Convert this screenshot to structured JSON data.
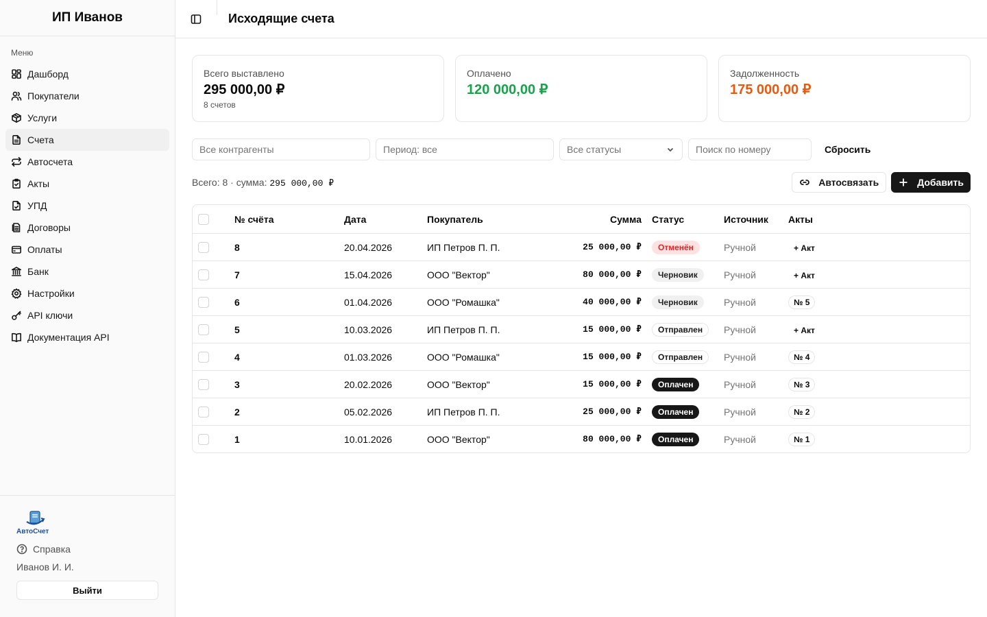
{
  "sidebar": {
    "brand": "ИП Иванов",
    "menu_title": "Меню",
    "items": [
      {
        "label": "Дашборд",
        "icon": "dashboard-icon"
      },
      {
        "label": "Покупатели",
        "icon": "users-icon"
      },
      {
        "label": "Услуги",
        "icon": "package-icon"
      },
      {
        "label": "Счета",
        "icon": "file-text-icon",
        "active": true
      },
      {
        "label": "Автосчета",
        "icon": "repeat-icon"
      },
      {
        "label": "Акты",
        "icon": "clipboard-check-icon"
      },
      {
        "label": "УПД",
        "icon": "file-check-icon"
      },
      {
        "label": "Договоры",
        "icon": "contract-icon"
      },
      {
        "label": "Оплаты",
        "icon": "wallet-icon"
      },
      {
        "label": "Банк",
        "icon": "bank-icon"
      },
      {
        "label": "Настройки",
        "icon": "gear-icon"
      },
      {
        "label": "API ключи",
        "icon": "key-icon"
      },
      {
        "label": "Документация API",
        "icon": "book-icon"
      }
    ],
    "footer": {
      "logo_text": "АвтоСчет",
      "help": "Справка",
      "user": "Иванов И. И.",
      "logout": "Выйти"
    }
  },
  "header": {
    "title": "Исходящие счета"
  },
  "cards": [
    {
      "label": "Всего выставлено",
      "value": "295 000,00 ₽",
      "sub": "8 счетов",
      "color": "#0a0a0a"
    },
    {
      "label": "Оплачено",
      "value": "120 000,00 ₽",
      "sub": "",
      "color": "#16a34a"
    },
    {
      "label": "Задолженность",
      "value": "175 000,00 ₽",
      "sub": "",
      "color": "#ea580c"
    }
  ],
  "filters": {
    "counterparty_placeholder": "Все контрагенты",
    "period_placeholder": "Период: все",
    "status_value": "Все статусы",
    "search_placeholder": "Поиск по номеру",
    "reset": "Сбросить"
  },
  "toolbar": {
    "totals_prefix": "Всего: 8 · сумма:",
    "totals_sum": "295 000,00 ₽",
    "autolink": "Автосвязать",
    "add": "Добавить"
  },
  "table": {
    "columns": [
      "№ счёта",
      "Дата",
      "Покупатель",
      "Сумма",
      "Статус",
      "Источник",
      "Акты"
    ],
    "rows": [
      {
        "num": "8",
        "date": "20.04.2026",
        "buyer": "ИП Петров П. П.",
        "sum": "25 000,00 ₽",
        "status": "Отменён",
        "status_kind": "cancel",
        "source": "Ручной",
        "act": "+ Акт",
        "act_kind": "add"
      },
      {
        "num": "7",
        "date": "15.04.2026",
        "buyer": "ООО \"Вектор\"",
        "sum": "80 000,00 ₽",
        "status": "Черновик",
        "status_kind": "draft",
        "source": "Ручной",
        "act": "+ Акт",
        "act_kind": "add"
      },
      {
        "num": "6",
        "date": "01.04.2026",
        "buyer": "ООО \"Ромашка\"",
        "sum": "40 000,00 ₽",
        "status": "Черновик",
        "status_kind": "draft",
        "source": "Ручной",
        "act": "№ 5",
        "act_kind": "chip"
      },
      {
        "num": "5",
        "date": "10.03.2026",
        "buyer": "ИП Петров П. П.",
        "sum": "15 000,00 ₽",
        "status": "Отправлен",
        "status_kind": "sent",
        "source": "Ручной",
        "act": "+ Акт",
        "act_kind": "add"
      },
      {
        "num": "4",
        "date": "01.03.2026",
        "buyer": "ООО \"Ромашка\"",
        "sum": "15 000,00 ₽",
        "status": "Отправлен",
        "status_kind": "sent",
        "source": "Ручной",
        "act": "№ 4",
        "act_kind": "chip"
      },
      {
        "num": "3",
        "date": "20.02.2026",
        "buyer": "ООО \"Вектор\"",
        "sum": "15 000,00 ₽",
        "status": "Оплачен",
        "status_kind": "paid",
        "source": "Ручной",
        "act": "№ 3",
        "act_kind": "chip"
      },
      {
        "num": "2",
        "date": "05.02.2026",
        "buyer": "ИП Петров П. П.",
        "sum": "25 000,00 ₽",
        "status": "Оплачен",
        "status_kind": "paid",
        "source": "Ручной",
        "act": "№ 2",
        "act_kind": "chip"
      },
      {
        "num": "1",
        "date": "10.01.2026",
        "buyer": "ООО \"Вектор\"",
        "sum": "80 000,00 ₽",
        "status": "Оплачен",
        "status_kind": "paid",
        "source": "Ручной",
        "act": "№ 1",
        "act_kind": "chip"
      }
    ]
  }
}
